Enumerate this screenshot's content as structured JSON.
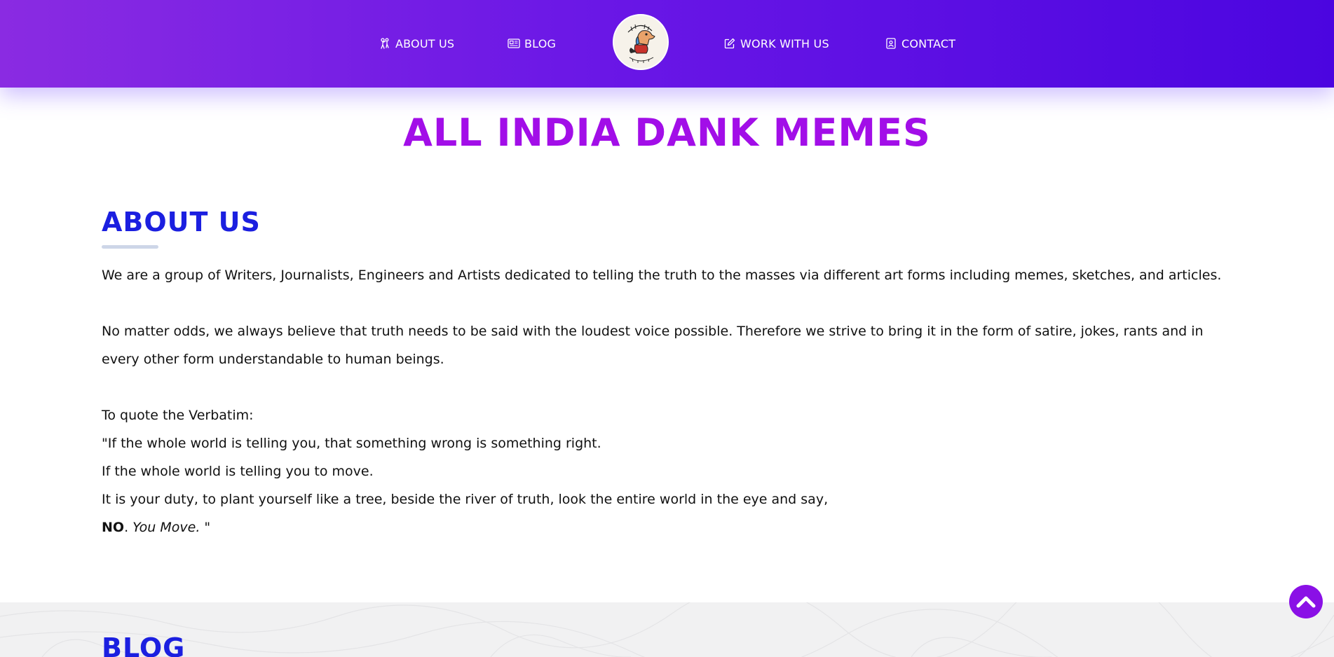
{
  "nav": {
    "about": {
      "label": "ABOUT US",
      "icon": "people-icon"
    },
    "blog": {
      "label": "BLOG",
      "icon": "newspaper-icon"
    },
    "work": {
      "label": "WORK WITH US",
      "icon": "edit-icon"
    },
    "contact": {
      "label": "CONTACT",
      "icon": "contact-card-icon"
    },
    "logo": {
      "alt": "All India Dank Memes logo"
    }
  },
  "site_title": "ALL INDIA DANK MEMES",
  "about": {
    "heading": "ABOUT US",
    "paragraph1": "We are a group of Writers, Journalists, Engineers and Artists dedicated to telling the truth to the masses via different art forms including memes, sketches, and articles.",
    "paragraph2": "No matter odds, we always believe that truth needs to be said with the loudest voice possible. Therefore we strive to bring it in the form of satire, jokes, rants and in every other form understandable to human beings.",
    "quote_intro": "To quote the Verbatim:",
    "quote_line1": "\"If the whole world is telling you, that something wrong is something right.",
    "quote_line2": "If the whole world is telling you to move.",
    "quote_line3": "It is your duty, to plant yourself like a tree, beside the river of truth, look the entire world in the eye and say,",
    "quote_no": "NO",
    "quote_punct": ".",
    "quote_you_move": "You Move.",
    "quote_end": " \""
  },
  "blog_section": {
    "heading": "BLOG"
  },
  "colors": {
    "nav_gradient_start": "#8a2be2",
    "nav_gradient_end": "#4b05e0",
    "title": "#a20ee8",
    "heading": "#1b1fe0",
    "scroll_top": "#8a10e6"
  }
}
